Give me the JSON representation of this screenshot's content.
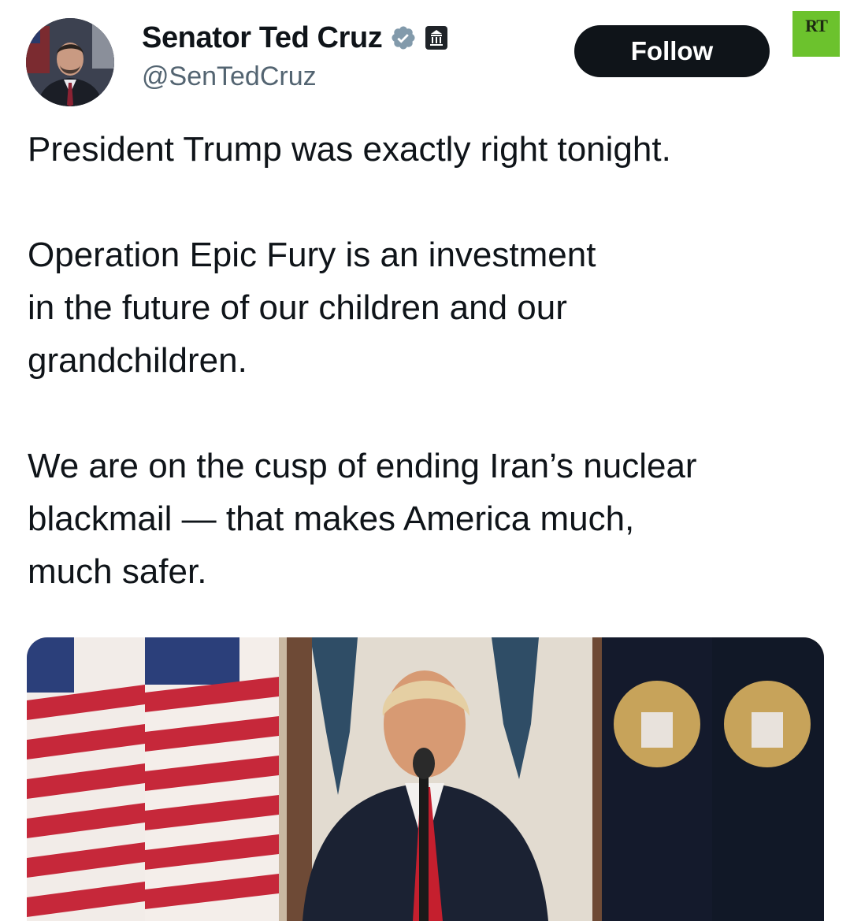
{
  "author": {
    "display_name": "Senator Ted Cruz",
    "handle": "@SenTedCruz",
    "avatar_icon": "person-avatar",
    "verified_icon": "verified-badge-icon",
    "verified_color": "#829aab",
    "affiliation_icon": "government-building-icon"
  },
  "follow_button": {
    "label": "Follow",
    "background": "#0f1419",
    "text_color": "#ffffff"
  },
  "watermark": {
    "text": "RT",
    "background": "#6cc22d"
  },
  "tweet": {
    "paragraphs": [
      "President Trump was exactly right tonight.",
      "Operation Epic Fury is an investment\nin the future of our children and our\ngrandchildren.",
      "We are on the cusp of ending Iran’s nuclear\nblackmail — that makes America much,\nmuch safer."
    ]
  },
  "media": {
    "type": "image",
    "subject": "man-speaking-at-microphone-with-flags"
  }
}
